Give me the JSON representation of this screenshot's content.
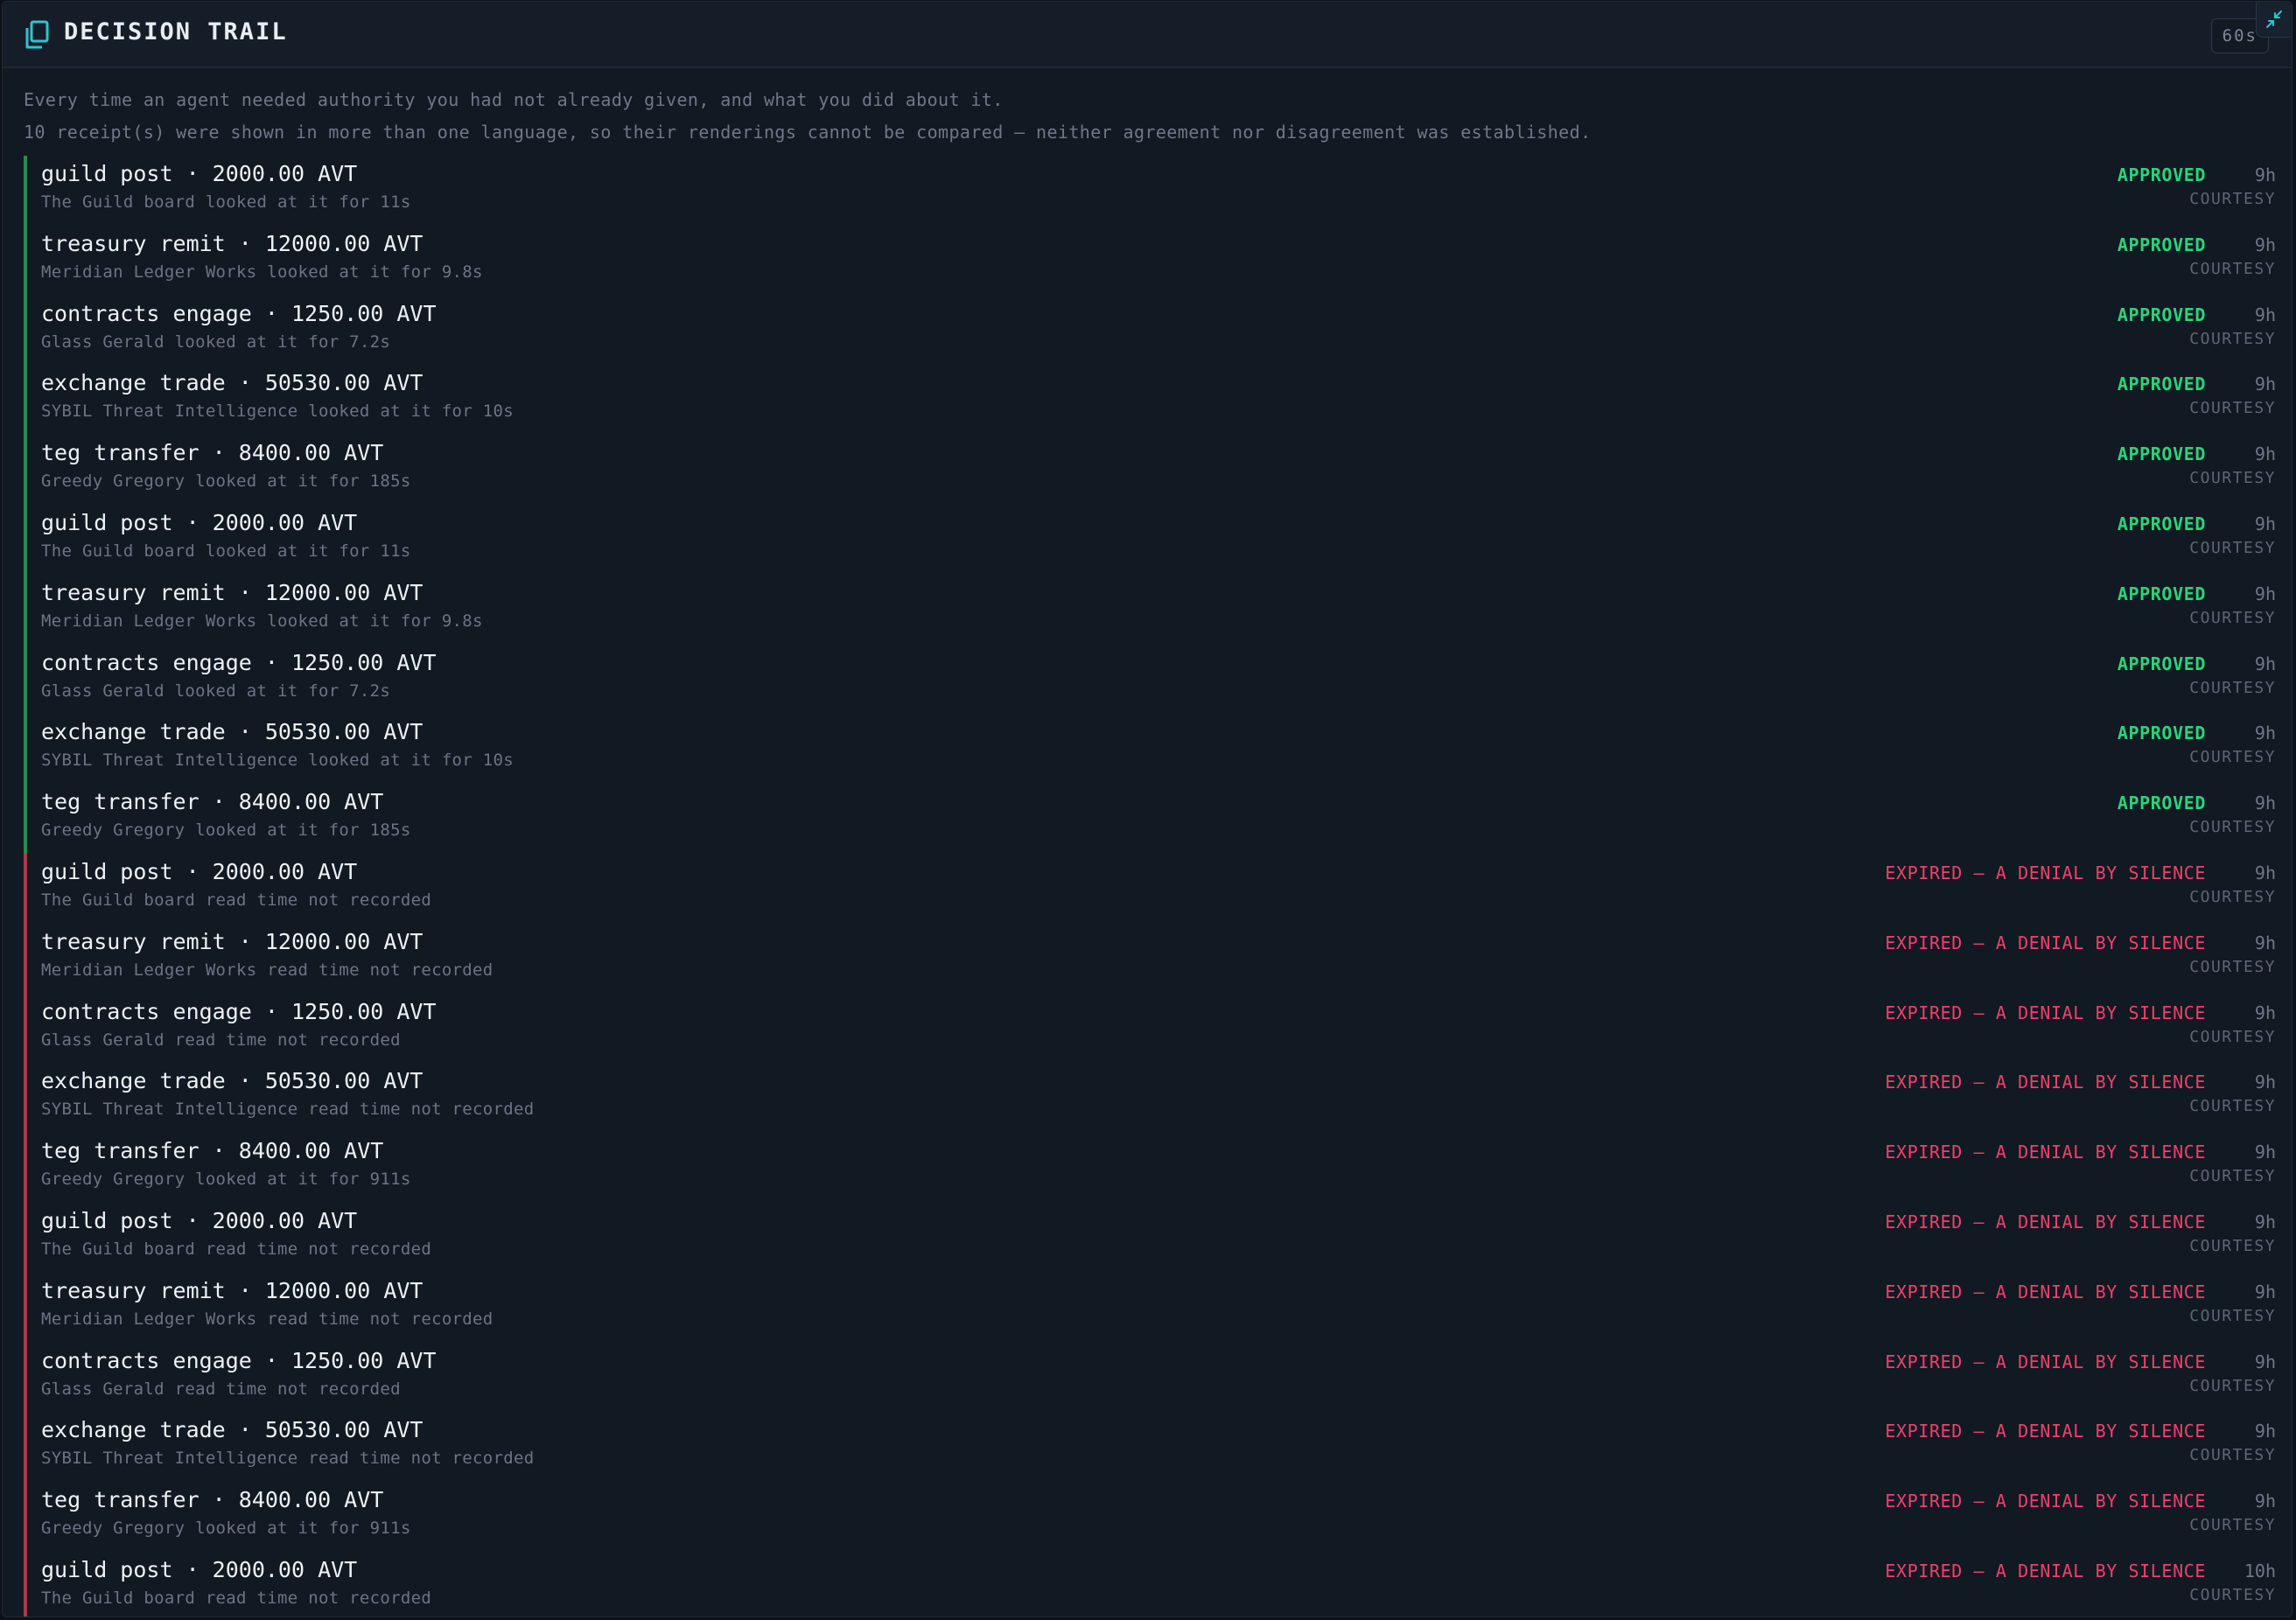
{
  "header": {
    "title": "DECISION TRAIL",
    "refresh_label": "60s",
    "title_icon": "document-copy-icon",
    "collapse_icon": "collapse-arrows-icon",
    "accent_color": "#2fc4cf"
  },
  "intro": {
    "line1": "Every time an agent needed authority you had not already given, and what you did about it.",
    "line2": "10 receipt(s) were shown in more than one language, so their renderings cannot be compared — neither agreement nor disagreement was established."
  },
  "colors": {
    "approved": "#2bd47a",
    "expired": "#f0406a",
    "approved_bar": "#2c8a4b",
    "expired_bar": "#a93a4c"
  },
  "decisions": [
    {
      "summary": "guild post · 2000.00 AVT",
      "detail": "The Guild board looked at it for 11s",
      "status": "APPROVED",
      "age": "9h",
      "tier": "COURTESY",
      "outcome": "approved"
    },
    {
      "summary": "treasury remit · 12000.00 AVT",
      "detail": "Meridian Ledger Works looked at it for 9.8s",
      "status": "APPROVED",
      "age": "9h",
      "tier": "COURTESY",
      "outcome": "approved"
    },
    {
      "summary": "contracts engage · 1250.00 AVT",
      "detail": "Glass Gerald looked at it for 7.2s",
      "status": "APPROVED",
      "age": "9h",
      "tier": "COURTESY",
      "outcome": "approved"
    },
    {
      "summary": "exchange trade · 50530.00 AVT",
      "detail": "SYBIL Threat Intelligence looked at it for 10s",
      "status": "APPROVED",
      "age": "9h",
      "tier": "COURTESY",
      "outcome": "approved"
    },
    {
      "summary": "teg transfer · 8400.00 AVT",
      "detail": "Greedy Gregory looked at it for 185s",
      "status": "APPROVED",
      "age": "9h",
      "tier": "COURTESY",
      "outcome": "approved"
    },
    {
      "summary": "guild post · 2000.00 AVT",
      "detail": "The Guild board looked at it for 11s",
      "status": "APPROVED",
      "age": "9h",
      "tier": "COURTESY",
      "outcome": "approved"
    },
    {
      "summary": "treasury remit · 12000.00 AVT",
      "detail": "Meridian Ledger Works looked at it for 9.8s",
      "status": "APPROVED",
      "age": "9h",
      "tier": "COURTESY",
      "outcome": "approved"
    },
    {
      "summary": "contracts engage · 1250.00 AVT",
      "detail": "Glass Gerald looked at it for 7.2s",
      "status": "APPROVED",
      "age": "9h",
      "tier": "COURTESY",
      "outcome": "approved"
    },
    {
      "summary": "exchange trade · 50530.00 AVT",
      "detail": "SYBIL Threat Intelligence looked at it for 10s",
      "status": "APPROVED",
      "age": "9h",
      "tier": "COURTESY",
      "outcome": "approved"
    },
    {
      "summary": "teg transfer · 8400.00 AVT",
      "detail": "Greedy Gregory looked at it for 185s",
      "status": "APPROVED",
      "age": "9h",
      "tier": "COURTESY",
      "outcome": "approved"
    },
    {
      "summary": "guild post · 2000.00 AVT",
      "detail": "The Guild board read time not recorded",
      "status": "EXPIRED — A DENIAL BY SILENCE",
      "age": "9h",
      "tier": "COURTESY",
      "outcome": "expired"
    },
    {
      "summary": "treasury remit · 12000.00 AVT",
      "detail": "Meridian Ledger Works read time not recorded",
      "status": "EXPIRED — A DENIAL BY SILENCE",
      "age": "9h",
      "tier": "COURTESY",
      "outcome": "expired"
    },
    {
      "summary": "contracts engage · 1250.00 AVT",
      "detail": "Glass Gerald read time not recorded",
      "status": "EXPIRED — A DENIAL BY SILENCE",
      "age": "9h",
      "tier": "COURTESY",
      "outcome": "expired"
    },
    {
      "summary": "exchange trade · 50530.00 AVT",
      "detail": "SYBIL Threat Intelligence read time not recorded",
      "status": "EXPIRED — A DENIAL BY SILENCE",
      "age": "9h",
      "tier": "COURTESY",
      "outcome": "expired"
    },
    {
      "summary": "teg transfer · 8400.00 AVT",
      "detail": "Greedy Gregory looked at it for 911s",
      "status": "EXPIRED — A DENIAL BY SILENCE",
      "age": "9h",
      "tier": "COURTESY",
      "outcome": "expired"
    },
    {
      "summary": "guild post · 2000.00 AVT",
      "detail": "The Guild board read time not recorded",
      "status": "EXPIRED — A DENIAL BY SILENCE",
      "age": "9h",
      "tier": "COURTESY",
      "outcome": "expired"
    },
    {
      "summary": "treasury remit · 12000.00 AVT",
      "detail": "Meridian Ledger Works read time not recorded",
      "status": "EXPIRED — A DENIAL BY SILENCE",
      "age": "9h",
      "tier": "COURTESY",
      "outcome": "expired"
    },
    {
      "summary": "contracts engage · 1250.00 AVT",
      "detail": "Glass Gerald read time not recorded",
      "status": "EXPIRED — A DENIAL BY SILENCE",
      "age": "9h",
      "tier": "COURTESY",
      "outcome": "expired"
    },
    {
      "summary": "exchange trade · 50530.00 AVT",
      "detail": "SYBIL Threat Intelligence read time not recorded",
      "status": "EXPIRED — A DENIAL BY SILENCE",
      "age": "9h",
      "tier": "COURTESY",
      "outcome": "expired"
    },
    {
      "summary": "teg transfer · 8400.00 AVT",
      "detail": "Greedy Gregory looked at it for 911s",
      "status": "EXPIRED — A DENIAL BY SILENCE",
      "age": "9h",
      "tier": "COURTESY",
      "outcome": "expired"
    },
    {
      "summary": "guild post · 2000.00 AVT",
      "detail": "The Guild board read time not recorded",
      "status": "EXPIRED — A DENIAL BY SILENCE",
      "age": "10h",
      "tier": "COURTESY",
      "outcome": "expired"
    }
  ]
}
